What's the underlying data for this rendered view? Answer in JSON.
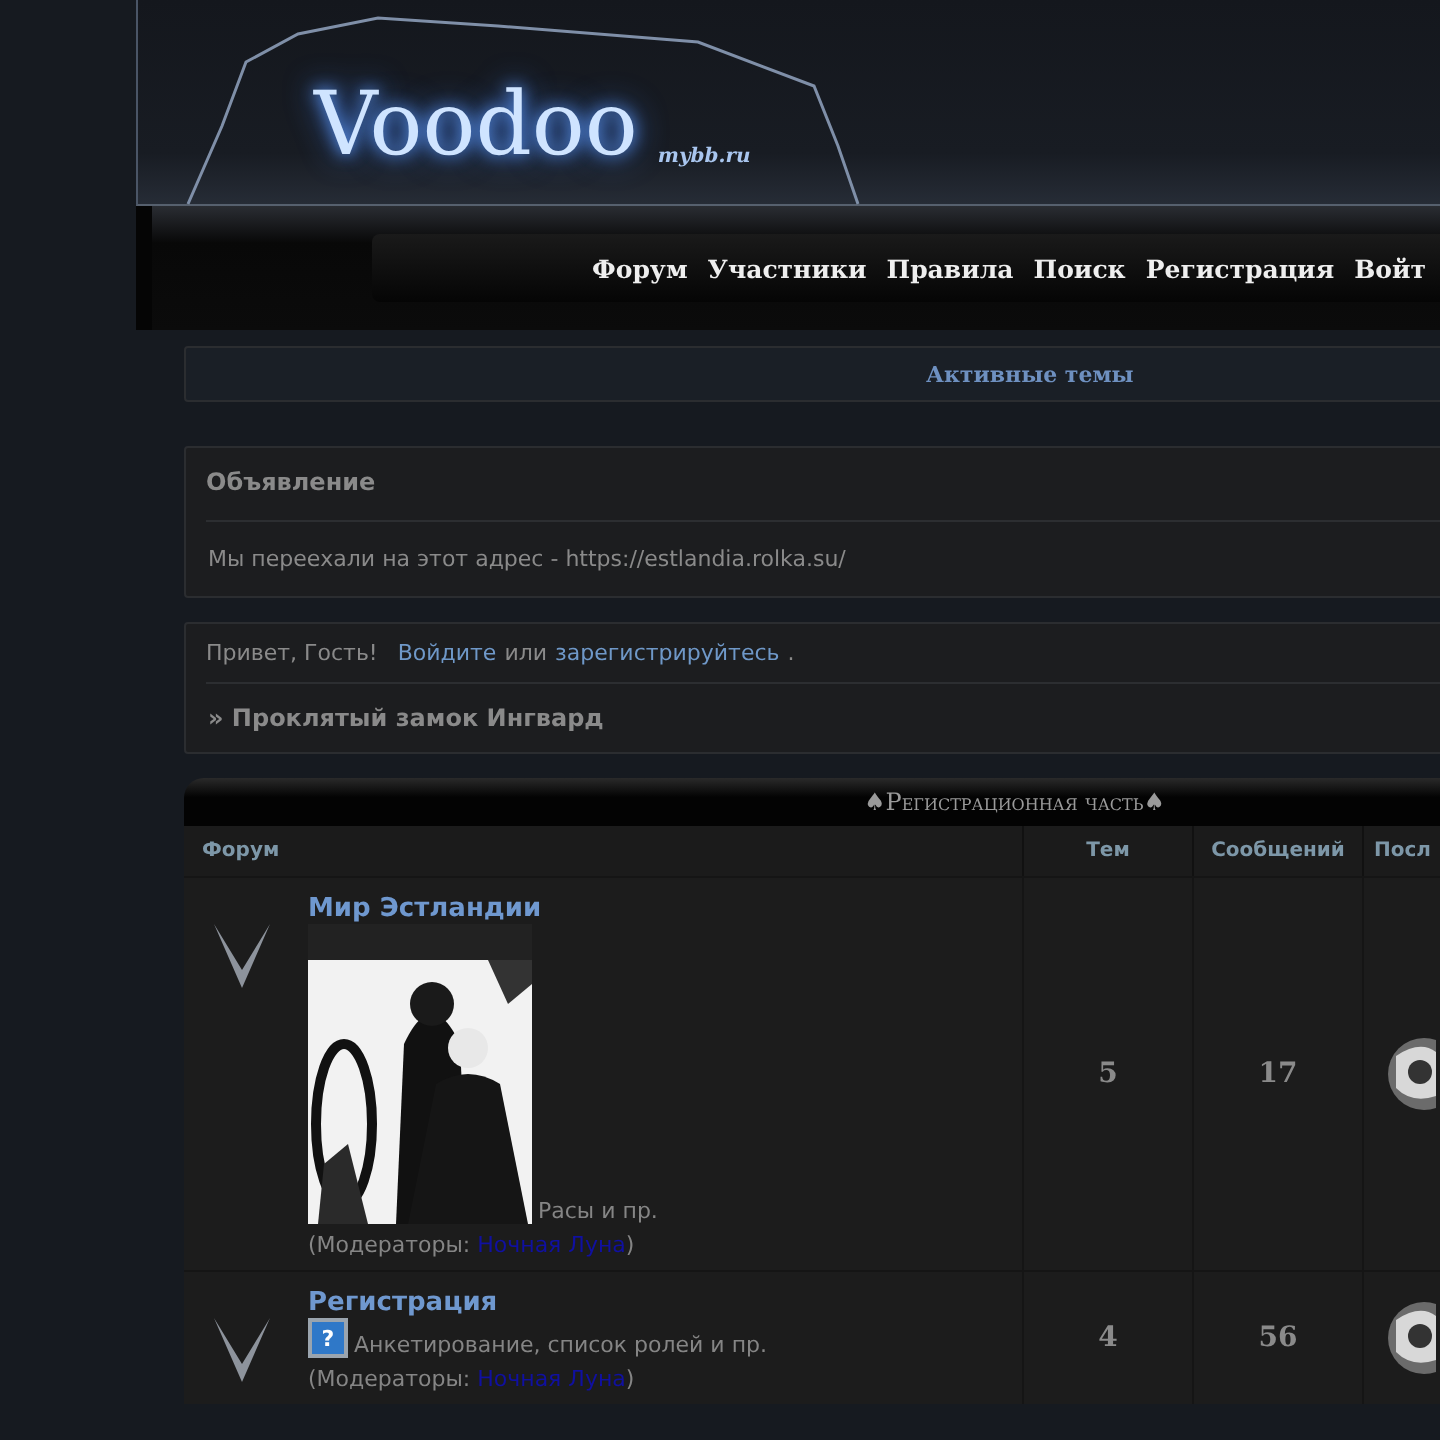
{
  "header": {
    "logo": "Voodoo",
    "logo_sub": "mybb.ru"
  },
  "nav": [
    "Форум",
    "Участники",
    "Правила",
    "Поиск",
    "Регистрация",
    "Войт"
  ],
  "active_topics": "Активные темы",
  "announcement": {
    "title": "Объявление",
    "text": "Мы переехали на этот адрес - https://estlandia.rolka.su/"
  },
  "welcome": {
    "greeting": "Привет, Гость!",
    "login": "Войдите",
    "or": "или",
    "register": "зарегистрируйтесь",
    "after": ".",
    "crumb": "» Проклятый замок Ингвард"
  },
  "category": {
    "title": "♠Регистрационная часть♠",
    "columns": [
      "Форум",
      "Тем",
      "Сообщений",
      "Посл"
    ],
    "forums": [
      {
        "name": "Мир Эстландии",
        "kind": "picture",
        "description": "Расы и пр.",
        "moderators_label": "(Модераторы: ",
        "moderator": "Ночная Луна",
        "moderators_end": ")",
        "topics": "5",
        "posts": "17"
      },
      {
        "name": "Регистрация",
        "kind": "icon",
        "icon_text": "?",
        "description": "Анкетирование, список ролей и пр.",
        "moderators_label": "(Модераторы: ",
        "moderator": "Ночная Луна",
        "moderators_end": ")",
        "topics": "4",
        "posts": "56"
      }
    ]
  }
}
